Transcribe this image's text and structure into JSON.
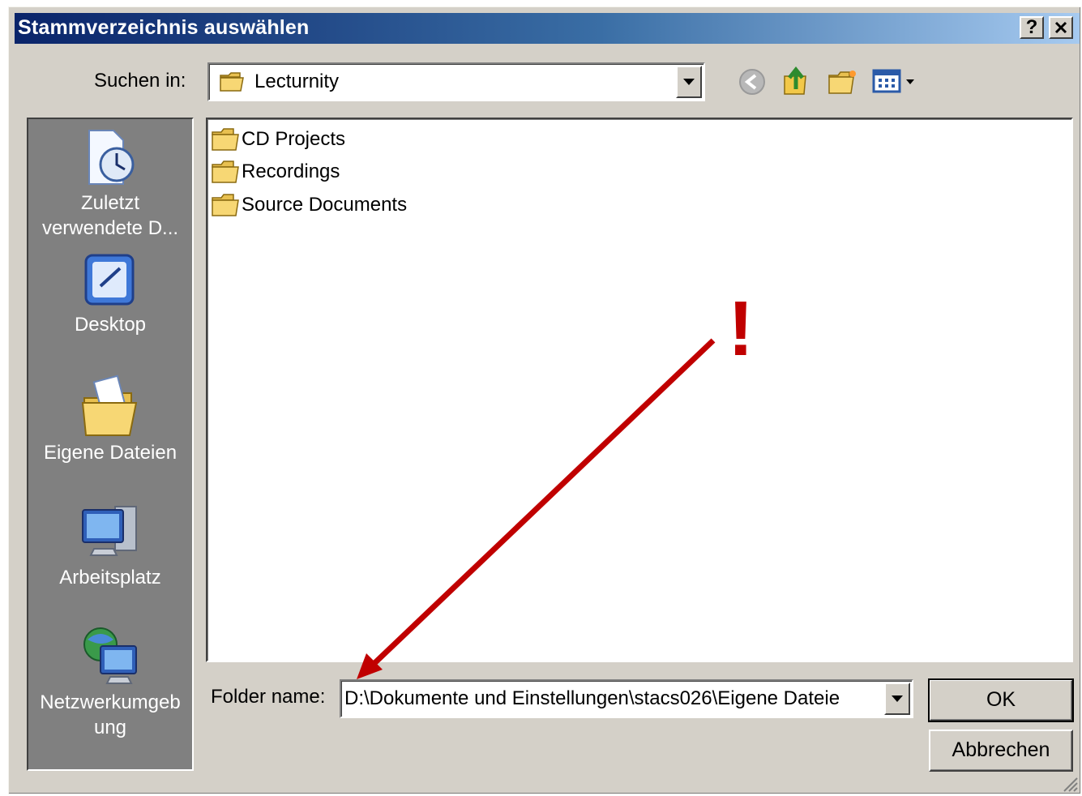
{
  "dialog": {
    "title": "Stammverzeichnis auswählen",
    "help_button": "?",
    "close_button": "✕"
  },
  "lookin": {
    "label": "Suchen in:",
    "value": "Lecturnity"
  },
  "toolbar": {
    "icons": [
      "back-icon",
      "up-folder-icon",
      "new-folder-icon",
      "view-menu-icon"
    ]
  },
  "places": [
    {
      "label": "Zuletzt verwendete D...",
      "icon": "recent-documents-icon"
    },
    {
      "label": "Desktop",
      "icon": "desktop-icon"
    },
    {
      "label": "Eigene Dateien",
      "icon": "my-documents-icon"
    },
    {
      "label": "Arbeitsplatz",
      "icon": "my-computer-icon"
    },
    {
      "label": "Netzwerkumgebung",
      "icon": "network-icon"
    }
  ],
  "files": [
    {
      "name": "CD Projects",
      "icon": "folder-icon"
    },
    {
      "name": "Recordings",
      "icon": "folder-icon"
    },
    {
      "name": "Source Documents",
      "icon": "folder-icon"
    }
  ],
  "foldername": {
    "label": "Folder name:",
    "value": "D:\\Dokumente und Einstellungen\\stacs026\\Eigene Dateie"
  },
  "buttons": {
    "ok": "OK",
    "cancel": "Abbrechen"
  },
  "annotation": {
    "mark": "!",
    "color": "#c00000"
  },
  "colors": {
    "title_start": "#0a246a",
    "title_end": "#a6caf0",
    "face": "#d4d0c8",
    "places_bg": "#808080"
  }
}
